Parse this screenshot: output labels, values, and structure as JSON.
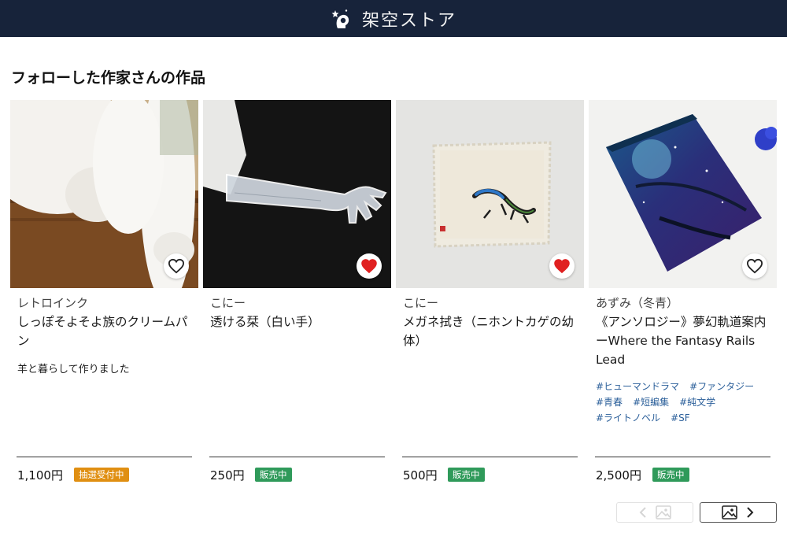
{
  "header": {
    "store_name": "架空ストア"
  },
  "section": {
    "title": "フォローした作家さんの作品"
  },
  "products": [
    {
      "author": "レトロインク",
      "title": "しっぽそよそよ族のクリームパン",
      "description": "羊と暮らして作りました",
      "tags": [],
      "price": "1,100円",
      "status": "抽選受付中",
      "status_color": "#e08f12",
      "favorited": false,
      "image_icon": "cat-paw-photo"
    },
    {
      "author": "こにー",
      "title": "透ける栞（白い手）",
      "description": "",
      "tags": [],
      "price": "250円",
      "status": "販売中",
      "status_color": "#2f9a5a",
      "favorited": true,
      "image_icon": "hand-bookmark-photo"
    },
    {
      "author": "こにー",
      "title": "メガネ拭き（ニホントカゲの幼体）",
      "description": "",
      "tags": [],
      "price": "500円",
      "status": "販売中",
      "status_color": "#2f9a5a",
      "favorited": true,
      "image_icon": "lizard-cloth-photo"
    },
    {
      "author": "あずみ（冬青）",
      "title": "《アンソロジー》夢幻軌道案内　ーWhere the Fantasy Rails Lead",
      "description": "",
      "tags": [
        "#ヒューマンドラマ",
        "#ファンタジー",
        "#青春",
        "#短編集",
        "#純文学",
        "#ライトノベル",
        "#SF"
      ],
      "price": "2,500円",
      "status": "販売中",
      "status_color": "#2f9a5a",
      "favorited": false,
      "image_icon": "galaxy-book-photo"
    }
  ],
  "pager": {
    "prev_icon": "chevron-left-icon",
    "next_icon": "chevron-right-icon",
    "image_icon": "image-icon"
  }
}
